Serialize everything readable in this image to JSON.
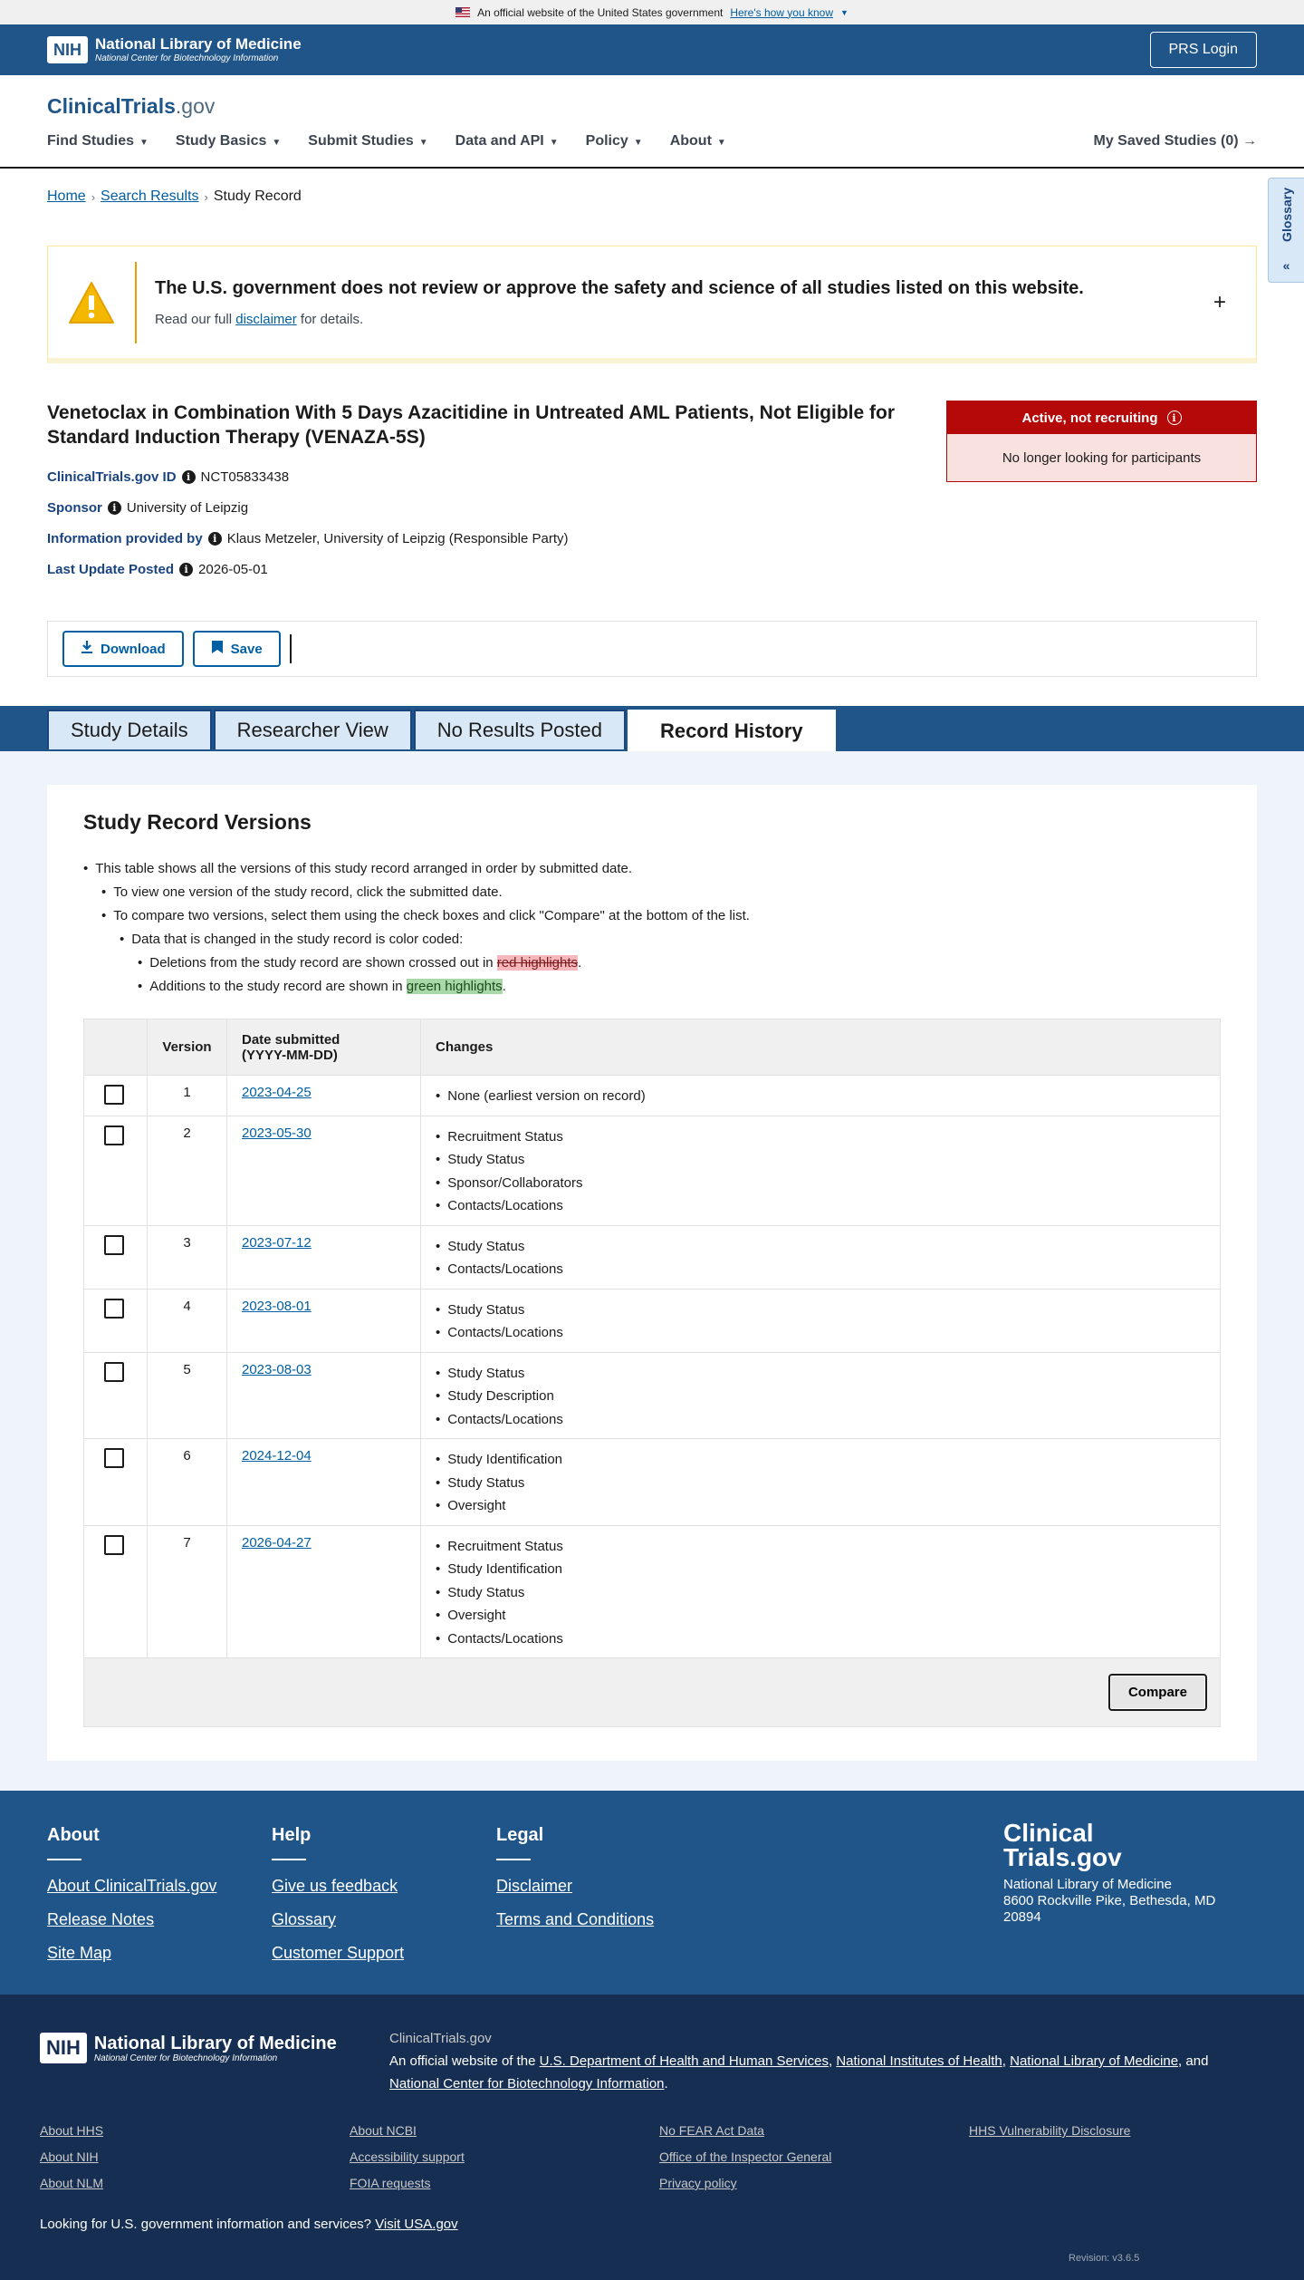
{
  "gov_banner": {
    "text": "An official website of the United States government",
    "link": "Here's how you know"
  },
  "nih_header": {
    "logo_box": "NIH",
    "title": "National Library of Medicine",
    "subtitle": "National Center for Biotechnology Information",
    "login": "PRS Login"
  },
  "site": {
    "logo_main": "ClinicalTrials",
    "logo_suffix": ".gov",
    "nav": [
      "Find Studies",
      "Study Basics",
      "Submit Studies",
      "Data and API",
      "Policy",
      "About"
    ],
    "saved": "My Saved Studies (0)",
    "glossary": "Glossary"
  },
  "breadcrumb": {
    "home": "Home",
    "search": "Search Results",
    "current": "Study Record"
  },
  "disclaimer": {
    "heading": "The U.S. government does not review or approve the safety and science of all studies listed on this website.",
    "pre": "Read our full",
    "link": "disclaimer",
    "post": "for details."
  },
  "study": {
    "title": "Venetoclax in Combination With 5 Days Azacitidine in Untreated AML Patients, Not Eligible for Standard Induction Therapy (VENAZA-5S)",
    "id_label": "ClinicalTrials.gov ID",
    "id": "NCT05833438",
    "sponsor_label": "Sponsor",
    "sponsor": "University of Leipzig",
    "provided_label": "Information provided by",
    "provided": "Klaus Metzeler, University of Leipzig (Responsible Party)",
    "updated_label": "Last Update Posted",
    "updated": "2026-05-01",
    "status": "Active, not recruiting",
    "status_detail": "No longer looking for participants"
  },
  "actions": {
    "download": "Download",
    "save": "Save"
  },
  "tabs": [
    "Study Details",
    "Researcher View",
    "No Results Posted",
    "Record History"
  ],
  "versions": {
    "heading": "Study Record Versions",
    "intro": {
      "l1": "This table shows all the versions of this study record arranged in order by submitted date.",
      "l2a": "To view one version of the study record, click the submitted date.",
      "l2b": "To compare two versions, select them using the check boxes and click \"Compare\" at the bottom of the list.",
      "l3": "Data that is changed in the study record is color coded:",
      "l4a_pre": "Deletions from the study record are shown crossed out in",
      "l4a_mark": "red highlights",
      "l4b_pre": "Additions to the study record are shown in",
      "l4b_mark": "green highlights"
    },
    "columns": {
      "version": "Version",
      "date_1": "Date submitted",
      "date_2": "(YYYY-MM-DD)",
      "changes": "Changes"
    },
    "rows": [
      {
        "version": "1",
        "date": "2023-04-25",
        "changes": [
          "None (earliest version on record)"
        ]
      },
      {
        "version": "2",
        "date": "2023-05-30",
        "changes": [
          "Recruitment Status",
          "Study Status",
          "Sponsor/Collaborators",
          "Contacts/Locations"
        ]
      },
      {
        "version": "3",
        "date": "2023-07-12",
        "changes": [
          "Study Status",
          "Contacts/Locations"
        ]
      },
      {
        "version": "4",
        "date": "2023-08-01",
        "changes": [
          "Study Status",
          "Contacts/Locations"
        ]
      },
      {
        "version": "5",
        "date": "2023-08-03",
        "changes": [
          "Study Status",
          "Study Description",
          "Contacts/Locations"
        ]
      },
      {
        "version": "6",
        "date": "2024-12-04",
        "changes": [
          "Study Identification",
          "Study Status",
          "Oversight"
        ]
      },
      {
        "version": "7",
        "date": "2026-04-27",
        "changes": [
          "Recruitment Status",
          "Study Identification",
          "Study Status",
          "Oversight",
          "Contacts/Locations"
        ]
      }
    ],
    "compare": "Compare"
  },
  "footer": {
    "about": {
      "heading": "About",
      "links": [
        "About ClinicalTrials.gov",
        "Release Notes",
        "Site Map"
      ]
    },
    "help": {
      "heading": "Help",
      "links": [
        "Give us feedback",
        "Glossary",
        "Customer Support"
      ]
    },
    "legal": {
      "heading": "Legal",
      "links": [
        "Disclaimer",
        "Terms and Conditions"
      ]
    },
    "brand_1": "Clinical",
    "brand_2": "Trials.gov",
    "address_1": "National Library of Medicine",
    "address_2": "8600 Rockville Pike, Bethesda, MD 20894"
  },
  "footer_bottom": {
    "site": "ClinicalTrials.gov",
    "official_pre": "An official website of the",
    "hhs": "U.S. Department of Health and Human Services",
    "nih": "National Institutes of Health",
    "nlm": "National Library of Medicine",
    "and": "and",
    "ncbi": "National Center for Biotechnology Information",
    "links": [
      [
        "About HHS",
        "About NIH",
        "About NLM"
      ],
      [
        "About NCBI",
        "Accessibility support",
        "FOIA requests"
      ],
      [
        "No FEAR Act Data",
        "Office of the Inspector General",
        "Privacy policy"
      ],
      [
        "HHS Vulnerability Disclosure"
      ]
    ],
    "usa_pre": "Looking for U.S. government information and services?",
    "usa_link": "Visit USA.gov",
    "revision": "Revision: v3.6.5"
  }
}
